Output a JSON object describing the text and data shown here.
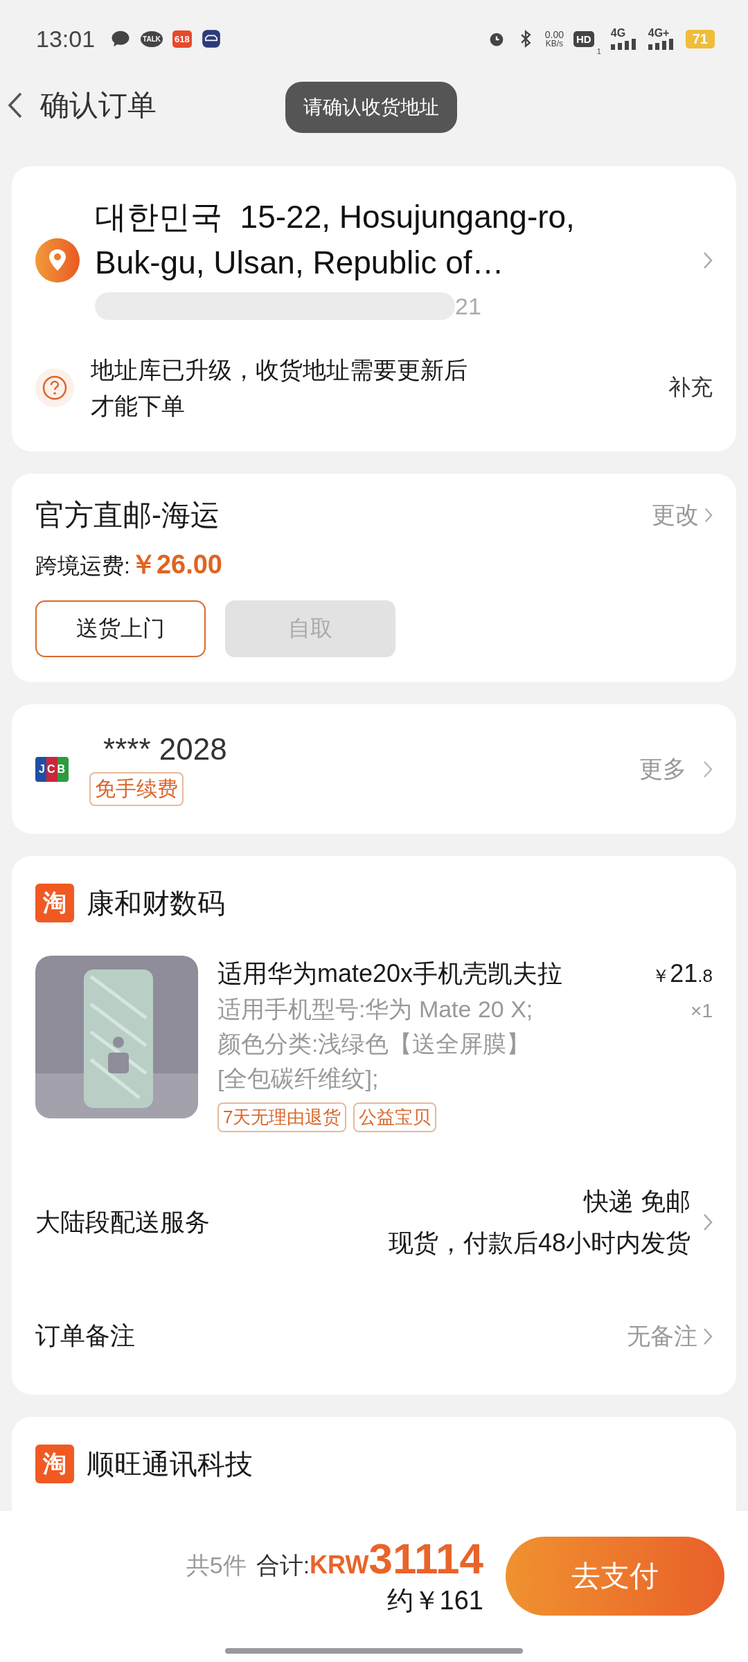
{
  "status_bar": {
    "time": "13:01",
    "talk_label": "TALK",
    "promo_label": "618",
    "net_speed": "0.00",
    "net_unit": "KB/s",
    "hd": "HD",
    "hd_sub": "1",
    "sim1": "4G",
    "sim2": "4G+",
    "battery": "71"
  },
  "header": {
    "title": "确认订单",
    "toast": "请确认收货地址"
  },
  "address": {
    "region": "대한민국",
    "line1": "15-22, Hosujungang-ro,",
    "line2": "Buk-gu, Ulsan, Republic of…",
    "phone_tail": "21",
    "notice": "地址库已升级，收货地址需要更新后才能下单",
    "notice_action": "补充"
  },
  "shipping": {
    "method": "官方直邮-海运",
    "change": "更改",
    "fee_label": "跨境运费:",
    "fee": "￥26.00",
    "options": [
      {
        "label": "送货上门",
        "selected": true
      },
      {
        "label": "自取",
        "selected": false
      }
    ]
  },
  "payment": {
    "brand": "JCB",
    "card": "**** 2028",
    "badge": "免手续费",
    "more": "更多"
  },
  "shops": [
    {
      "badge": "淘",
      "name": "康和财数码",
      "items": [
        {
          "title": "适用华为mate20x手机壳凯夫拉",
          "specs": [
            "适用手机型号:华为 Mate 20 X;",
            "颜色分类:浅绿色【送全屏膜】[全包碳纤维纹];"
          ],
          "price_symbol": "￥",
          "price_int": "21",
          "price_dec": ".8",
          "qty": "×1",
          "tags": [
            "7天无理由退货",
            "公益宝贝"
          ]
        }
      ],
      "delivery_label": "大陆段配送服务",
      "delivery_method": "快递 免邮",
      "delivery_time": "现货，付款后48小时内发货",
      "note_label": "订单备注",
      "note_value": "无备注"
    },
    {
      "badge": "淘",
      "name": "顺旺通讯科技"
    }
  ],
  "footer": {
    "count": "共5件",
    "total_label": "合计:",
    "currency": "KRW",
    "amount": "31114",
    "approx": "约￥161",
    "pay": "去支付"
  }
}
